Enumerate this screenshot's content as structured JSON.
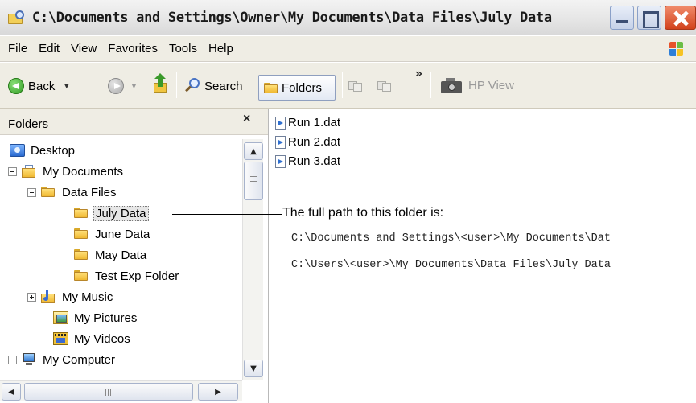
{
  "window": {
    "title": "C:\\Documents and Settings\\Owner\\My Documents\\Data Files\\July Data"
  },
  "menu": [
    "File",
    "Edit",
    "View",
    "Favorites",
    "Tools",
    "Help"
  ],
  "toolbar": {
    "back_label": "Back",
    "search_label": "Search",
    "folders_label": "Folders",
    "more_label": "»",
    "hp_view_label": "HP View"
  },
  "folders_pane": {
    "title": "Folders",
    "close_label": "×",
    "tree": [
      {
        "label": "Desktop",
        "icon": "desktop-icon"
      },
      {
        "label": "My Documents",
        "icon": "my-documents-icon",
        "expander": "minus"
      },
      {
        "label": "Data Files",
        "icon": "folder-icon",
        "expander": "minus"
      },
      {
        "label": "July Data",
        "icon": "folder-icon",
        "selected": true
      },
      {
        "label": "June Data",
        "icon": "folder-icon"
      },
      {
        "label": "May Data",
        "icon": "folder-icon"
      },
      {
        "label": "Test Exp Folder",
        "icon": "folder-icon"
      },
      {
        "label": "My Music",
        "icon": "my-music-icon",
        "expander": "plus"
      },
      {
        "label": "My Pictures",
        "icon": "my-pictures-icon"
      },
      {
        "label": "My Videos",
        "icon": "my-videos-icon"
      },
      {
        "label": "My Computer",
        "icon": "my-computer-icon",
        "expander": "minus"
      }
    ]
  },
  "files": [
    {
      "name": "Run 1.dat"
    },
    {
      "name": "Run 2.dat"
    },
    {
      "name": "Run 3.dat"
    }
  ],
  "annotation": {
    "title": "The full path to this folder is:",
    "paths": [
      "C:\\Documents and Settings\\<user>\\My Documents\\Dat",
      "C:\\Users\\<user>\\My Documents\\Data Files\\July Data"
    ]
  },
  "colors": {
    "chrome": "#efede4",
    "close_button": "#d2421c",
    "folder": "#f0b932"
  }
}
